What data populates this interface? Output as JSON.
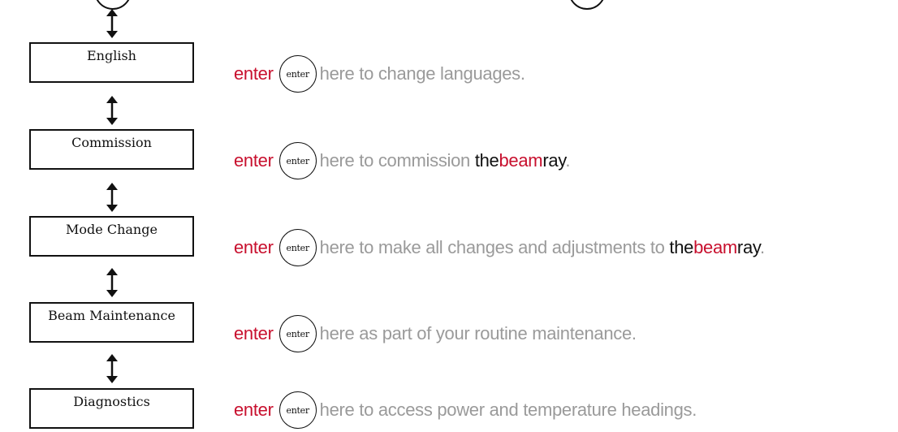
{
  "colors": {
    "accent": "#c8102e",
    "text": "#111111",
    "muted": "#9a9a9a"
  },
  "menu": [
    {
      "label": "English",
      "action": "enter",
      "key": "enter",
      "desc": "here to change languages.",
      "brand": null
    },
    {
      "label": "Commission",
      "action": "enter",
      "key": "enter",
      "desc": "here to commission ",
      "brand": {
        "the": "the",
        "beam": "beam",
        "ray": "ray",
        "suffix": "."
      }
    },
    {
      "label": "Mode Change",
      "action": "enter",
      "key": "enter",
      "desc": "here to make all changes and adjustments to ",
      "brand": {
        "the": "the",
        "beam": "beam",
        "ray": "ray",
        "suffix": "."
      }
    },
    {
      "label": "Beam Maintenance",
      "action": "enter",
      "key": "enter",
      "desc": "here as part of your routine maintenance.",
      "brand": null
    },
    {
      "label": "Diagnostics",
      "action": "enter",
      "key": "enter",
      "desc": "here to access power and temperature headings.",
      "brand": null
    }
  ]
}
